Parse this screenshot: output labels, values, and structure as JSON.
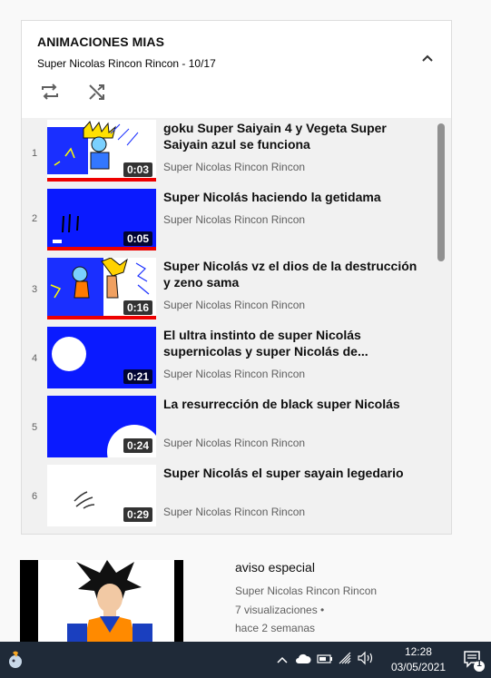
{
  "playlist": {
    "title": "ANIMACIONES MIAS",
    "subtitle": "Super Nicolas Rincon Rincon - 10/17",
    "items": [
      {
        "index": "1",
        "title": "goku Super Saiyain 4 y Vegeta Super Saiyain azul se funciona",
        "channel": "Super Nicolas Rincon Rincon",
        "duration": "0:03",
        "watched": 1.0
      },
      {
        "index": "2",
        "title": "Super Nicolás haciendo la getidama",
        "channel": "Super Nicolas Rincon Rincon",
        "duration": "0:05",
        "watched": 1.0
      },
      {
        "index": "3",
        "title": "Super Nicolás vz el dios de la destrucción y zeno sama",
        "channel": "Super Nicolas Rincon Rincon",
        "duration": "0:16",
        "watched": 1.0
      },
      {
        "index": "4",
        "title": "El ultra instinto de super Nicolás supernicolas y super Nicolás de...",
        "channel": "Super Nicolas Rincon Rincon",
        "duration": "0:21",
        "watched": 0
      },
      {
        "index": "5",
        "title": "La resurrección de black super Nicolás",
        "channel": "Super Nicolas Rincon Rincon",
        "duration": "0:24",
        "watched": 0
      },
      {
        "index": "6",
        "title": "Super Nicolás el super sayain legedario",
        "channel": "Super Nicolas Rincon Rincon",
        "duration": "0:29",
        "watched": 0
      }
    ]
  },
  "recommendation": {
    "title": "aviso especial",
    "channel": "Super Nicolas Rincon Rincon",
    "views": "7 visualizaciones •",
    "age": "hace 2 semanas"
  },
  "taskbar": {
    "time": "12:28",
    "date": "03/05/2021",
    "notification_count": "1"
  },
  "icons": [
    "repeat-icon",
    "shuffle-icon",
    "chevron-up-icon",
    "chevron-up-tray-icon",
    "cloud-icon",
    "battery-icon",
    "wifi-icon",
    "volume-icon",
    "notification-icon"
  ],
  "colors": {
    "thumb_blue": "#0000ff",
    "progress_red": "#ee0000",
    "taskbar": "#1f2a38"
  }
}
